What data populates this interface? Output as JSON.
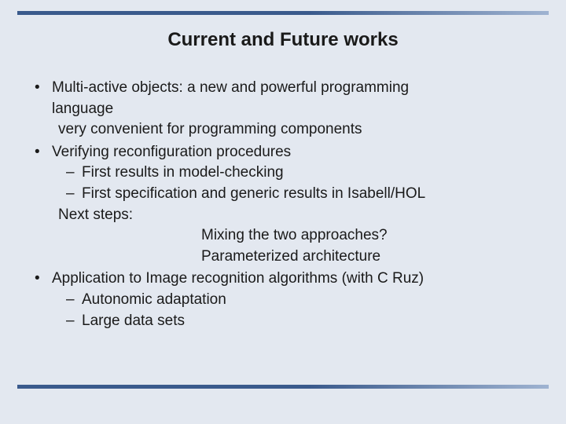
{
  "title": "Current and Future works",
  "bullets": {
    "b1_line1": "Multi-active objects: a new and powerful programming",
    "b1_line2": "language",
    "b1_cont": "very convenient for programming components",
    "b2": "Verifying reconfiguration procedures",
    "b2_s1": "First results in model-checking",
    "b2_s2": "First specification and generic results in Isabell/HOL",
    "b2_next": "Next steps:",
    "b2_c1": "Mixing the two approaches?",
    "b2_c2": "Parameterized architecture",
    "b3": "Application to Image recognition algorithms (with C Ruz)",
    "b3_s1": "Autonomic adaptation",
    "b3_s2": "Large data sets"
  }
}
